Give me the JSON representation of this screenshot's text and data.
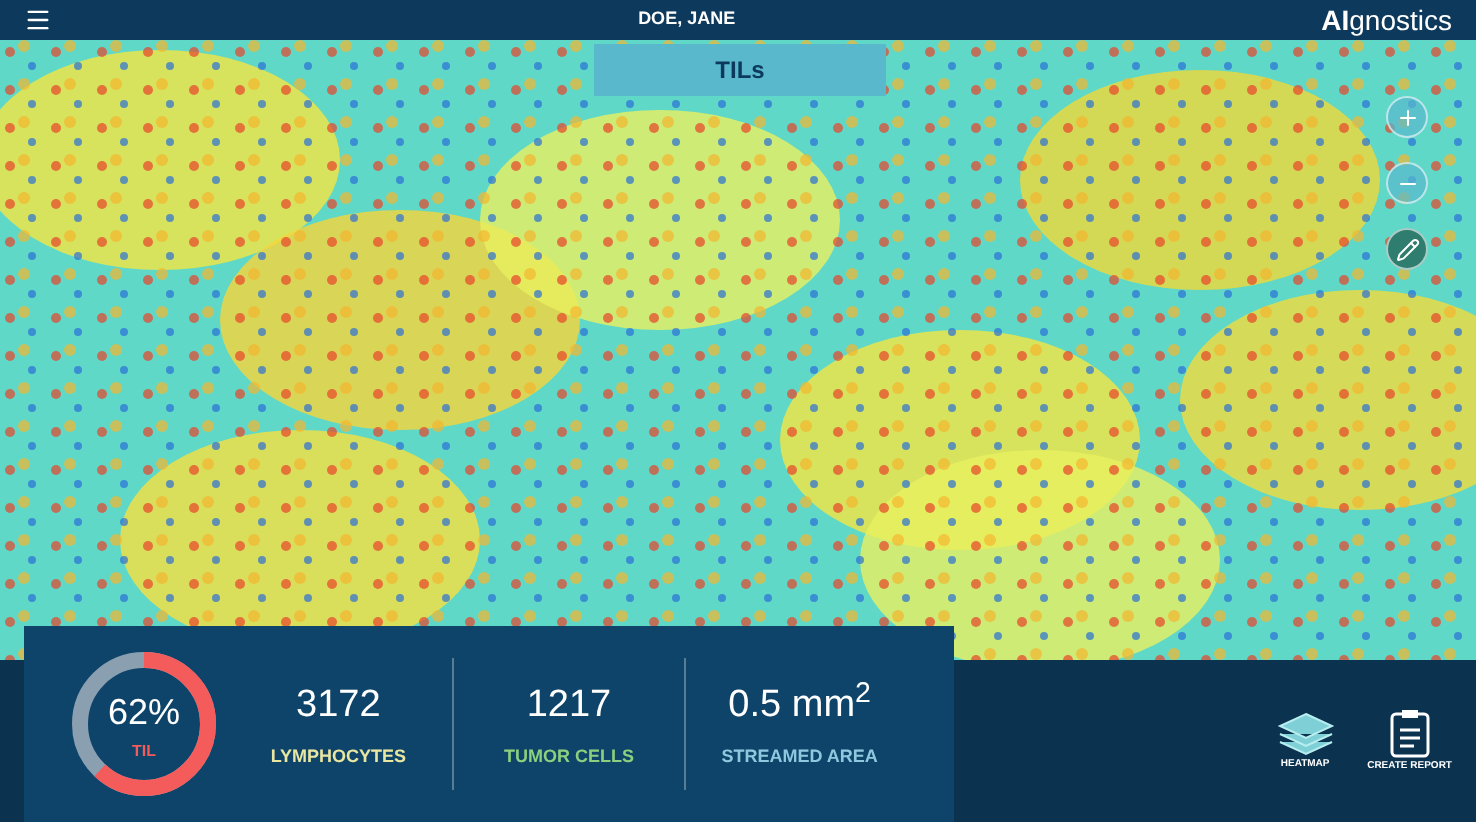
{
  "header": {
    "patient": "DOE, JANE",
    "logo_bold": "AI",
    "logo_rest": "gnostics"
  },
  "viewer": {
    "kind": "picture",
    "tab": "TILs",
    "tools": [
      {
        "kind": "zoom-in"
      },
      {
        "kind": "zoom-out"
      },
      {
        "kind": "draw",
        "selected": true
      }
    ]
  },
  "stats": {
    "til": {
      "value": "62%",
      "label": "TIL",
      "level": 0.62
    },
    "metrics": [
      {
        "value": "3172",
        "label": "LYMPHOCYTES",
        "color": "#e8e6a0"
      },
      {
        "value": "1217",
        "label": "TUMOR CELLS",
        "color": "#8ccf7e"
      },
      {
        "value": "0.5 mm$^{2}$",
        "label": "STREAMED AREA",
        "color": "#8ec8de"
      }
    ]
  },
  "actions": [
    {
      "kind": "heatmap",
      "label": "HEATMAP"
    },
    {
      "kind": "report",
      "label": "CREATE REPORT"
    }
  ]
}
